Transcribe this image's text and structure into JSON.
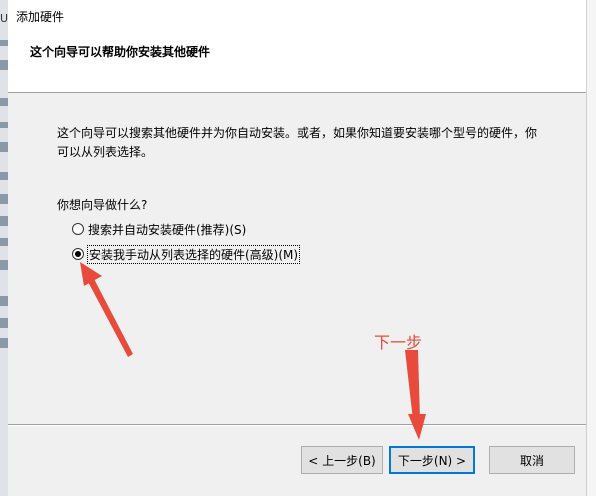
{
  "background": {
    "left_edge_letter": "U"
  },
  "window": {
    "title": "添加硬件"
  },
  "header": {
    "heading": "这个向导可以帮助你安装其他硬件"
  },
  "content": {
    "description_line1": "这个向导可以搜索其他硬件并为你自动安装。或者，如果你知道要安装哪个型号的硬件，你",
    "description_line2": "可以从列表选择。",
    "question": "你想向导做什么?",
    "options": [
      {
        "label": "搜索并自动安装硬件(推荐)(S)",
        "checked": false
      },
      {
        "label": "安装我手动从列表选择的硬件(高级)(M)",
        "checked": true
      }
    ]
  },
  "buttons": {
    "back_label": "< 上一步(B)",
    "next_label": "下一步(N) >",
    "cancel_label": "取消"
  },
  "annotation": {
    "text": "下一步",
    "color": "#e84a3c"
  },
  "colors": {
    "dialog_bg": "#f0f0f0",
    "default_button_border": "#0078d7"
  }
}
